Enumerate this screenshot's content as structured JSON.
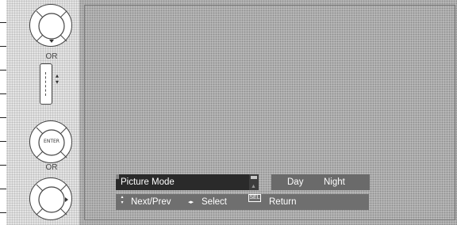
{
  "remote": {
    "or_top": "OR",
    "or_bottom": "OR",
    "enter_label": "ENTER",
    "rocker_arrows": "▴\n▾",
    "icons": [
      "dpad-down-icon",
      "updown-rocker-icon",
      "enter-button-icon",
      "dpad-right-icon"
    ]
  },
  "osd": {
    "menu_label": "Picture Mode",
    "options": {
      "day": "Day",
      "night": "Night"
    },
    "help": {
      "updown_glyph": "▴\n▾",
      "next_prev": "Next/Prev",
      "lr_glyph": "◂▸",
      "select": "Select",
      "sel_key": "SEL",
      "return": "Return"
    }
  },
  "colors": {
    "screen_bg": "#bcbcbc",
    "menu_highlight": "#2a2a2a",
    "option_bar": "#6a6a6a",
    "help_bar": "#6f6f6f"
  }
}
